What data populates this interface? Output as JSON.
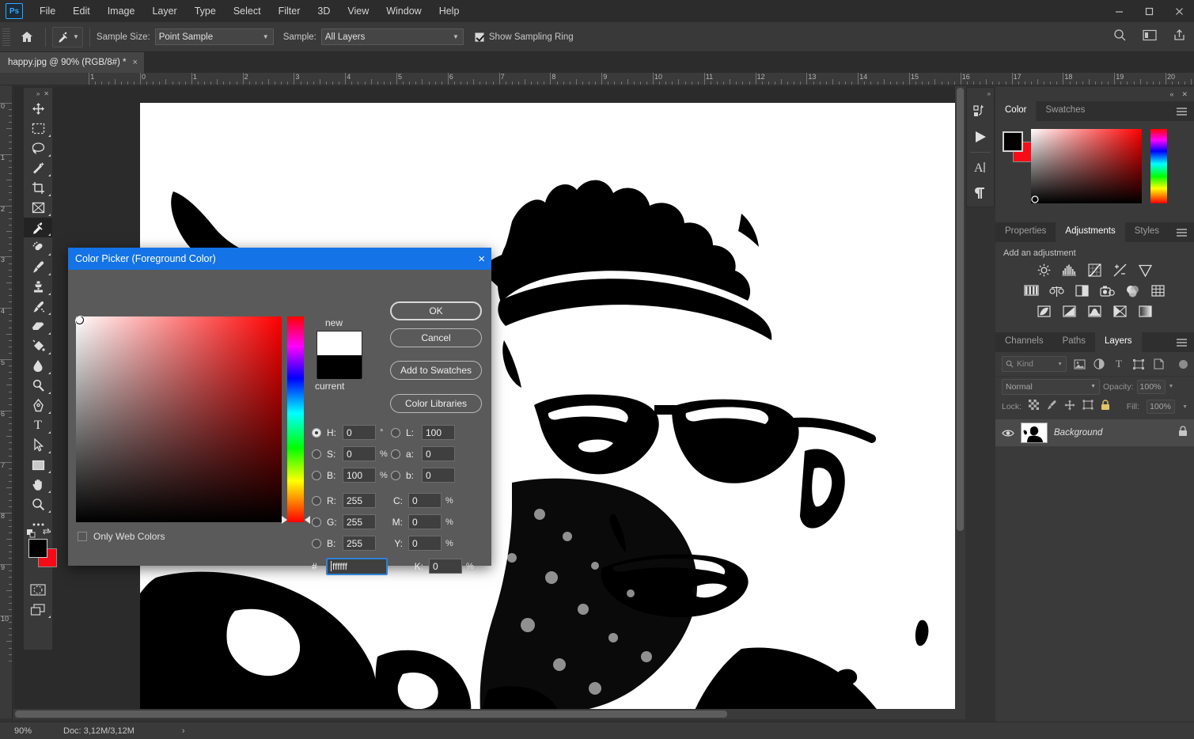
{
  "app": {
    "logo": "Ps",
    "menus": [
      "File",
      "Edit",
      "Image",
      "Layer",
      "Type",
      "Select",
      "Filter",
      "3D",
      "View",
      "Window",
      "Help"
    ],
    "window_controls": [
      "minimize",
      "maximize",
      "close"
    ]
  },
  "options_bar": {
    "home_icon": "home-icon",
    "tool_icon": "eyedropper-icon",
    "sample_size_label": "Sample Size:",
    "sample_size_value": "Point Sample",
    "sample_label": "Sample:",
    "sample_value": "All Layers",
    "show_sampling_ring_label": "Show Sampling Ring",
    "show_sampling_ring_checked": true,
    "right_icons": [
      "search-icon",
      "workspace-icon",
      "share-icon"
    ]
  },
  "document_tab": {
    "title": "happy.jpg @ 90% (RGB/8#) *",
    "close": "×"
  },
  "rulers": {
    "horizontal_labels": [
      "1",
      "0",
      "1",
      "2",
      "3",
      "4",
      "5",
      "6",
      "7",
      "8",
      "9",
      "10",
      "11",
      "12",
      "13",
      "14",
      "15",
      "16",
      "17",
      "18",
      "19",
      "20"
    ],
    "vertical_labels": [
      "0",
      "1",
      "2",
      "3",
      "4",
      "5",
      "6",
      "7",
      "8",
      "9",
      "10"
    ]
  },
  "toolbar": {
    "tools": [
      {
        "name": "move-tool",
        "glyph": "move"
      },
      {
        "name": "rectangular-marquee-tool",
        "glyph": "marquee"
      },
      {
        "name": "lasso-tool",
        "glyph": "lasso"
      },
      {
        "name": "object-selection-tool",
        "glyph": "wand"
      },
      {
        "name": "crop-tool",
        "glyph": "crop"
      },
      {
        "name": "frame-tool",
        "glyph": "frame"
      },
      {
        "name": "eyedropper-tool",
        "glyph": "eyedropper",
        "active": true
      },
      {
        "name": "spot-healing-brush-tool",
        "glyph": "healing"
      },
      {
        "name": "brush-tool",
        "glyph": "brush"
      },
      {
        "name": "clone-stamp-tool",
        "glyph": "stamp"
      },
      {
        "name": "history-brush-tool",
        "glyph": "historybrush"
      },
      {
        "name": "eraser-tool",
        "glyph": "eraser"
      },
      {
        "name": "gradient-tool",
        "glyph": "bucket"
      },
      {
        "name": "blur-tool",
        "glyph": "drop"
      },
      {
        "name": "dodge-tool",
        "glyph": "dodge"
      },
      {
        "name": "pen-tool",
        "glyph": "pen"
      },
      {
        "name": "type-tool",
        "glyph": "type"
      },
      {
        "name": "path-selection-tool",
        "glyph": "arrow"
      },
      {
        "name": "rectangle-tool",
        "glyph": "rect"
      },
      {
        "name": "hand-tool",
        "glyph": "hand"
      },
      {
        "name": "zoom-tool",
        "glyph": "zoom"
      },
      {
        "name": "edit-toolbar-button",
        "glyph": "ellipsis"
      }
    ],
    "foreground_color": "#000000",
    "background_color": "#f60c18",
    "quick_mask": "quick-mask-icon",
    "screen_mode": "screen-mode-icon"
  },
  "narrow_dock": {
    "buttons": [
      "history-icon",
      "actions-play-icon",
      "character-icon",
      "paragraph-icon"
    ]
  },
  "panels": {
    "color": {
      "tabs": [
        {
          "label": "Color",
          "active": true
        },
        {
          "label": "Swatches",
          "active": false
        }
      ],
      "foreground_color": "#000000",
      "background_color": "#f60c18"
    },
    "adjustments": {
      "tabs": [
        {
          "label": "Properties",
          "active": false
        },
        {
          "label": "Adjustments",
          "active": true
        },
        {
          "label": "Styles",
          "active": false
        }
      ],
      "heading": "Add an adjustment",
      "icons_row1": [
        "brightness-contrast-icon",
        "levels-icon",
        "curves-icon",
        "exposure-icon",
        "vibrance-icon"
      ],
      "icons_row2": [
        "hue-saturation-icon",
        "color-balance-icon",
        "black-white-icon",
        "photo-filter-icon",
        "channel-mixer-icon",
        "color-lookup-icon"
      ],
      "icons_row3": [
        "invert-icon",
        "posterize-icon",
        "threshold-icon",
        "selective-color-icon",
        "gradient-map-icon"
      ]
    },
    "layers": {
      "tabs": [
        {
          "label": "Channels",
          "active": false
        },
        {
          "label": "Paths",
          "active": false
        },
        {
          "label": "Layers",
          "active": true
        }
      ],
      "filter_value": "Kind",
      "filter_icons": [
        "pixel-filter-icon",
        "adjustment-filter-icon",
        "type-filter-icon",
        "shape-filter-icon",
        "smart-object-filter-icon"
      ],
      "blend_mode": "Normal",
      "opacity_label": "Opacity:",
      "opacity_value": "100%",
      "lock_label": "Lock:",
      "lock_icons": [
        "lock-transparent-pixels-icon",
        "lock-image-pixels-icon",
        "lock-position-icon",
        "lock-artboard-icon",
        "lock-all-icon"
      ],
      "fill_label": "Fill:",
      "fill_value": "100%",
      "rows": [
        {
          "name": "Background",
          "visible": true,
          "locked": true
        }
      ]
    }
  },
  "color_picker": {
    "title": "Color Picker (Foreground Color)",
    "close": "×",
    "new_label": "new",
    "current_label": "current",
    "new_color": "#ffffff",
    "current_color": "#000000",
    "buttons": [
      {
        "label": "OK",
        "primary": true
      },
      {
        "label": "Cancel",
        "primary": false
      },
      {
        "label": "Add to Swatches",
        "primary": false
      },
      {
        "label": "Color Libraries",
        "primary": false
      }
    ],
    "only_web_colors_label": "Only Web Colors",
    "only_web_colors_checked": false,
    "selected_mode": "H",
    "hsb": [
      {
        "key": "H",
        "label": "H:",
        "value": "0",
        "unit": "°",
        "selected": true
      },
      {
        "key": "S",
        "label": "S:",
        "value": "0",
        "unit": "%",
        "selected": false
      },
      {
        "key": "B",
        "label": "B:",
        "value": "100",
        "unit": "%",
        "selected": false
      }
    ],
    "lab": [
      {
        "key": "L",
        "label": "L:",
        "value": "100",
        "unit": "",
        "selected": false
      },
      {
        "key": "a",
        "label": "a:",
        "value": "0",
        "unit": "",
        "selected": false
      },
      {
        "key": "b",
        "label": "b:",
        "value": "0",
        "unit": "",
        "selected": false
      }
    ],
    "rgb": [
      {
        "key": "R",
        "label": "R:",
        "value": "255",
        "selected": false
      },
      {
        "key": "G",
        "label": "G:",
        "value": "255",
        "selected": false
      },
      {
        "key": "B",
        "label": "B:",
        "value": "255",
        "selected": false
      }
    ],
    "cmyk": [
      {
        "key": "C",
        "label": "C:",
        "value": "0",
        "unit": "%"
      },
      {
        "key": "M",
        "label": "M:",
        "value": "0",
        "unit": "%"
      },
      {
        "key": "Y",
        "label": "Y:",
        "value": "0",
        "unit": "%"
      },
      {
        "key": "K",
        "label": "K:",
        "value": "0",
        "unit": "%"
      }
    ],
    "hex_label": "#",
    "hex_value": "ffffff"
  },
  "status_bar": {
    "zoom": "90%",
    "doc_info": "Doc: 3,12M/3,12M",
    "arrow": "›"
  },
  "colors": {
    "accent": "#1473e6",
    "chrome": "#393939",
    "panel": "#3a3a3a",
    "canvas_bg": "#2b2b2b",
    "menubar": "#2c2c2c"
  }
}
